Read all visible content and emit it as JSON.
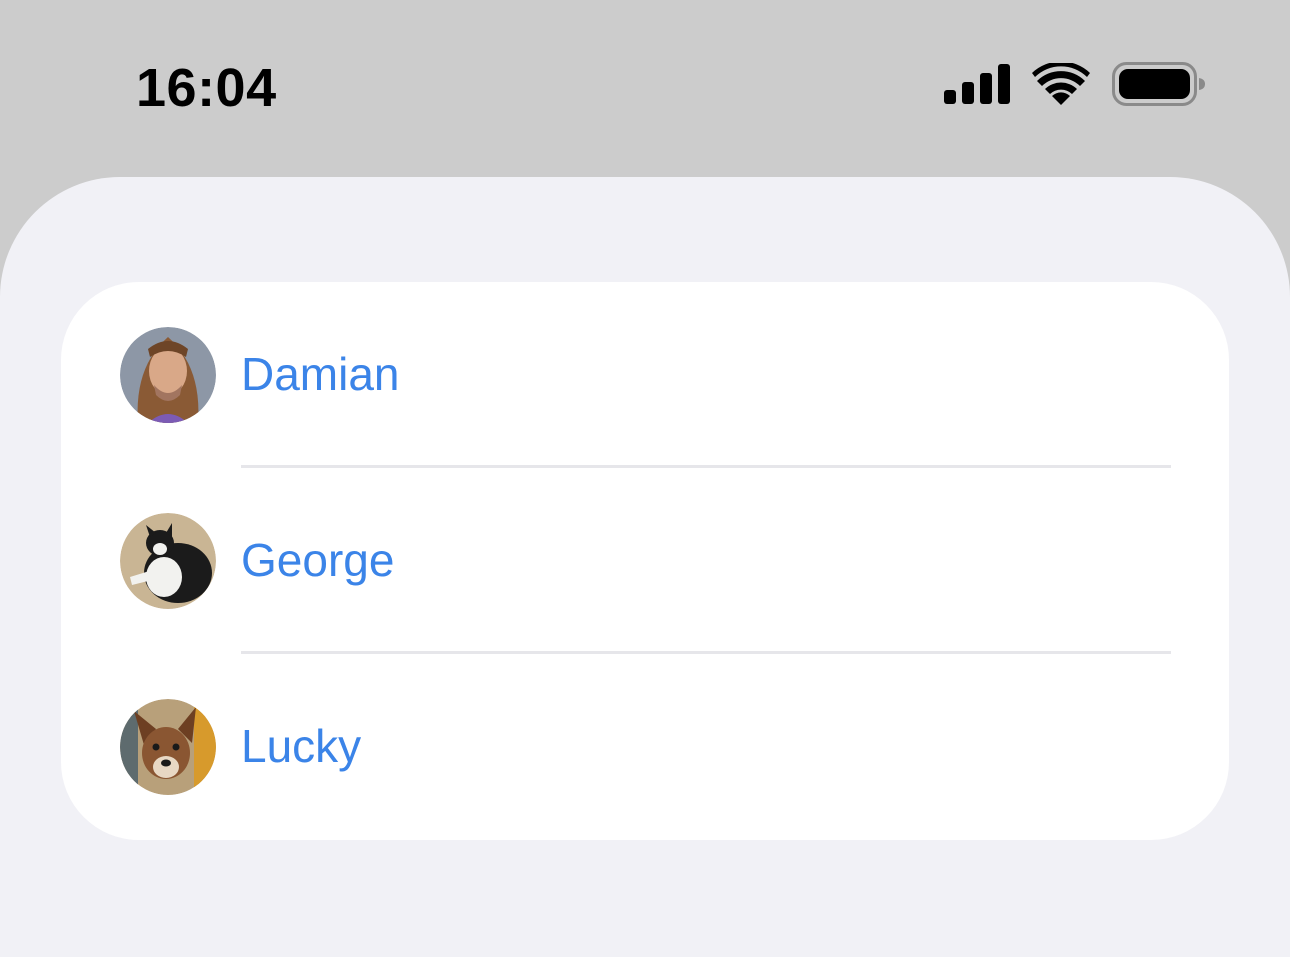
{
  "status_bar": {
    "time": "16:04",
    "icons": [
      "cellular-signal-icon",
      "wifi-icon",
      "battery-icon"
    ]
  },
  "contacts": [
    {
      "name": "Damian",
      "avatar": "person-photo"
    },
    {
      "name": "George",
      "avatar": "cat-photo"
    },
    {
      "name": "Lucky",
      "avatar": "dog-photo"
    }
  ],
  "colors": {
    "accent": "#3b84e8",
    "status_bar_bg": "#cccccc",
    "sheet_bg": "#f1f1f6",
    "card_bg": "#ffffff",
    "separator": "#e6e6ea"
  }
}
